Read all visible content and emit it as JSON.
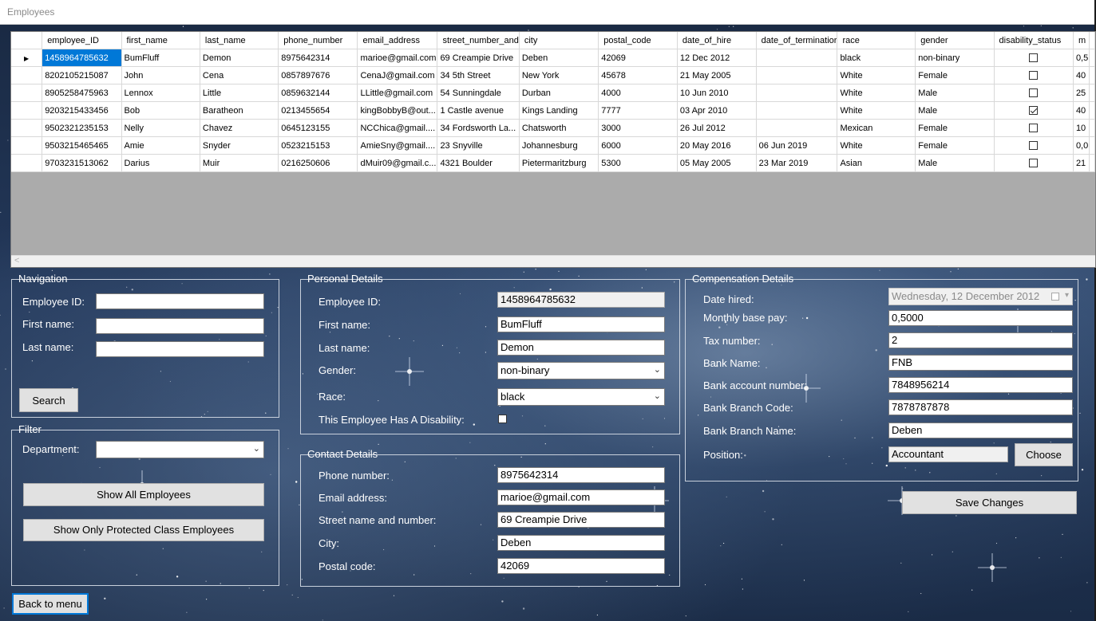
{
  "window": {
    "title": "Employees"
  },
  "grid": {
    "columns": [
      "employee_ID",
      "first_name",
      "last_name",
      "phone_number",
      "email_address",
      "street_number_and",
      "city",
      "postal_code",
      "date_of_hire",
      "date_of_terminatior",
      "race",
      "gender",
      "disability_status",
      "m"
    ],
    "rows": [
      [
        "1458964785632",
        "BumFluff",
        "Demon",
        "8975642314",
        "marioe@gmail.com",
        "69 Creampie Drive",
        "Deben",
        "42069",
        "12 Dec 2012",
        "",
        "black",
        "non-binary",
        false,
        "0,5"
      ],
      [
        "8202105215087",
        "John",
        "Cena",
        "0857897676",
        "CenaJ@gmail.com",
        "34 5th Street",
        "New York",
        "45678",
        "21 May 2005",
        "",
        "White",
        "Female",
        false,
        "40"
      ],
      [
        "8905258475963",
        "Lennox",
        "Little",
        "0859632144",
        "LLittle@gmail.com",
        "54 Sunningdale",
        "Durban",
        "4000",
        "10 Jun 2010",
        "",
        "White",
        "Male",
        false,
        "25"
      ],
      [
        "9203215433456",
        "Bob",
        "Baratheon",
        "0213455654",
        "kingBobbyB@out...",
        "1 Castle avenue",
        "Kings Landing",
        "7777",
        "03 Apr 2010",
        "",
        "White",
        "Male",
        true,
        "40"
      ],
      [
        "9502321235153",
        "Nelly",
        "Chavez",
        "0645123155",
        "NCChica@gmail....",
        "34 Fordsworth La...",
        "Chatsworth",
        "3000",
        "26 Jul 2012",
        "",
        "Mexican",
        "Female",
        false,
        "10"
      ],
      [
        "9503215465465",
        "Amie",
        "Snyder",
        "0523215153",
        "AmieSny@gmail....",
        "23 Snyville",
        "Johannesburg",
        "6000",
        "20 May 2016",
        "06 Jun 2019",
        "White",
        "Female",
        false,
        "0,0"
      ],
      [
        "9703231513062",
        "Darius",
        "Muir",
        "0216250606",
        "dMuir09@gmail.c...",
        "4321 Boulder",
        "Pietermaritzburg",
        "5300",
        "05 May 2005",
        "23 Mar 2019",
        "Asian",
        "Male",
        false,
        "21"
      ]
    ],
    "scroll_left_arrow": "<"
  },
  "navigation": {
    "legend": "Navigation",
    "employee_id_label": "Employee ID:",
    "first_name_label": "First name:",
    "last_name_label": "Last name:",
    "employee_id_value": "",
    "first_name_value": "",
    "last_name_value": "",
    "search_label": "Search"
  },
  "filter": {
    "legend": "Filter",
    "department_label": "Department:",
    "department_value": "",
    "show_all_label": "Show All Employees",
    "show_protected_label": "Show Only Protected Class Employees"
  },
  "personal": {
    "legend": "Personal Details",
    "employee_id_label": "Employee ID:",
    "employee_id_value": "1458964785632",
    "first_name_label": "First name:",
    "first_name_value": "BumFluff",
    "last_name_label": "Last name:",
    "last_name_value": "Demon",
    "gender_label": "Gender:",
    "gender_value": "non-binary",
    "race_label": "Race:",
    "race_value": "black",
    "disability_label": "This Employee Has A Disability:",
    "disability_checked": false
  },
  "contact": {
    "legend": "Contact Details",
    "phone_label": "Phone number:",
    "phone_value": "8975642314",
    "email_label": "Email address:",
    "email_value": "marioe@gmail.com",
    "street_label": "Street name and number:",
    "street_value": "69 Creampie Drive",
    "city_label": "City:",
    "city_value": "Deben",
    "postal_label": "Postal code:",
    "postal_value": "42069"
  },
  "compensation": {
    "legend": "Compensation Details",
    "date_hired_label": "Date hired:",
    "date_hired_value": "Wednesday, 12 December 2012",
    "base_pay_label": "Monthly base pay:",
    "base_pay_value": "0,5000",
    "tax_label": "Tax number:",
    "tax_value": "2",
    "bank_name_label": "Bank Name:",
    "bank_name_value": "FNB",
    "bank_account_label": "Bank account number:",
    "bank_account_value": "7848956214",
    "branch_code_label": "Bank Branch Code:",
    "branch_code_value": "7878787878",
    "branch_name_label": "Bank Branch Name:",
    "branch_name_value": "Deben",
    "position_label": "Position:",
    "position_value": "Accountant",
    "choose_label": "Choose",
    "save_label": "Save Changes"
  },
  "back_label": "Back to menu",
  "colors": {
    "selection": "#0078d7",
    "grid_empty": "#ababab",
    "button": "#e1e1e1"
  },
  "icons": {
    "row_pointer": "triangle-right-icon",
    "dropdown": "chevron-down-icon",
    "calendar": "calendar-icon"
  }
}
